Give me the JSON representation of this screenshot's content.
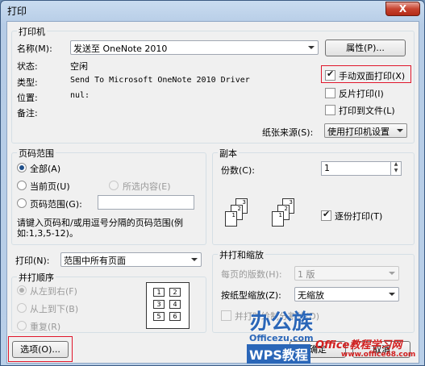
{
  "window": {
    "title": "打印",
    "close_label": "X"
  },
  "printer": {
    "group_title": "打印机",
    "name_label": "名称(M):",
    "name_value": "发送至 OneNote 2010",
    "properties_button": "属性(P)...",
    "status_label": "状态:",
    "status_value": "空闲",
    "type_label": "类型:",
    "type_value": "Send To Microsoft OneNote 2010 Driver",
    "location_label": "位置:",
    "location_value": "nul:",
    "comment_label": "备注:",
    "manual_duplex": "手动双面打印(X)",
    "reverse_print": "反片打印(I)",
    "print_to_file": "打印到文件(L)",
    "paper_source_label": "纸张来源(S):",
    "paper_source_value": "使用打印机设置"
  },
  "page_range": {
    "group_title": "页码范围",
    "all": "全部(A)",
    "current_page": "当前页(U)",
    "selection": "所选内容(E)",
    "pages": "页码范围(G):",
    "hint": "请键入页码和/或用逗号分隔的页码范围(例如:1,3,5-12)。"
  },
  "copies": {
    "group_title": "副本",
    "count_label": "份数(C):",
    "count_value": "1",
    "collate": "逐份打印(T)",
    "page_numbers": [
      "1",
      "2",
      "3",
      "1",
      "2",
      "3"
    ]
  },
  "print_what": {
    "label": "打印(N):",
    "value": "范围中所有页面"
  },
  "order": {
    "group_title": "并打顺序",
    "left_to_right": "从左到右(F)",
    "top_to_bottom": "从上到下(B)",
    "repeat": "重复(R)",
    "grid_numbers": [
      "1",
      "2",
      "3",
      "4",
      "5",
      "6"
    ]
  },
  "zoom": {
    "group_title": "并打和缩放",
    "pages_per_sheet_label": "每页的版数(H):",
    "pages_per_sheet_value": "1 版",
    "scale_label": "按纸型缩放(Z):",
    "scale_value": "无缩放",
    "draw_lines": "并打时绘制分割线(D)"
  },
  "buttons": {
    "options": "选项(O)...",
    "ok": "确定",
    "cancel": "取消"
  },
  "watermarks": {
    "logo_main": "办公族",
    "logo_url": "Officezu.com",
    "logo_wps": "WPS教程",
    "site_name": "Office教程学习网",
    "site_url": "www.office68.com"
  },
  "colors": {
    "accent": "#1f4f8a",
    "highlight_box": "#e0162b"
  }
}
